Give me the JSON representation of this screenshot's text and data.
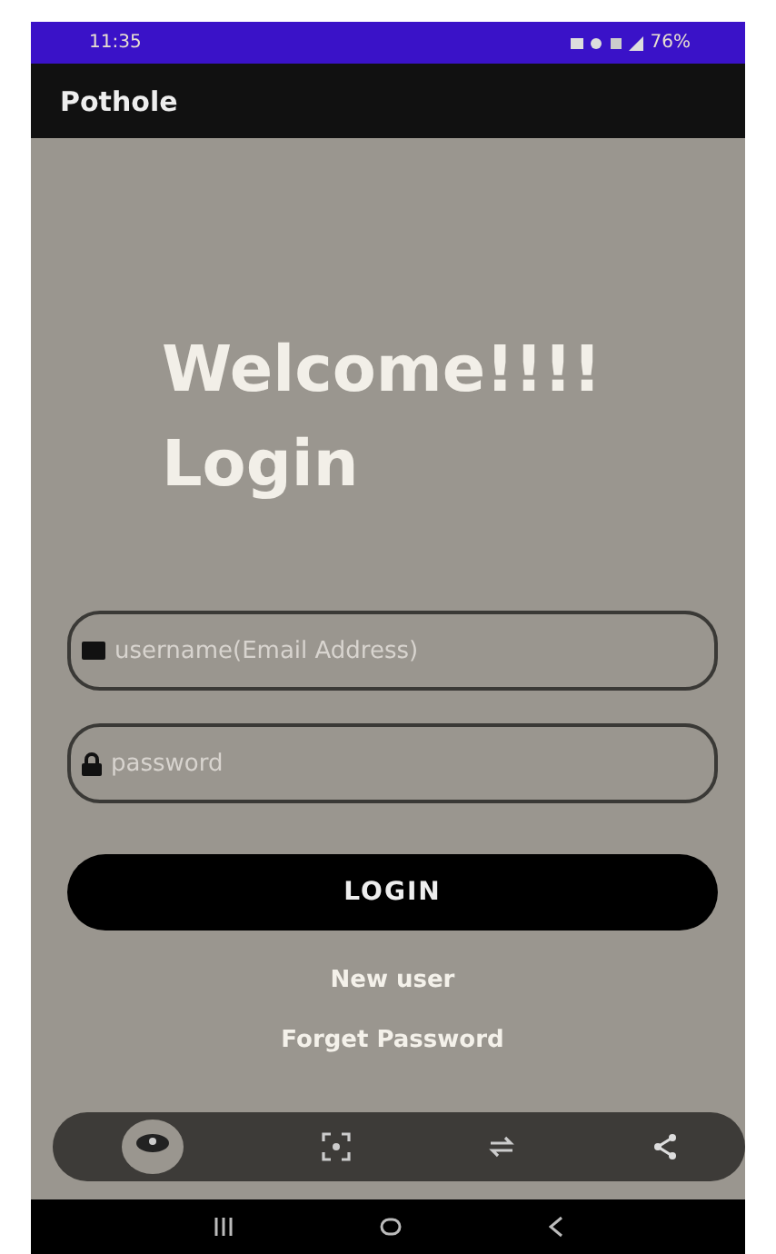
{
  "status_bar": {
    "time": "11:35",
    "battery": "76%"
  },
  "app_bar": {
    "title": "Pothole"
  },
  "heading": {
    "line_1": "Welcome!!!!",
    "line_2": "Login"
  },
  "fields": [
    {
      "kind": "email",
      "placeholder": "username(Email Address)"
    },
    {
      "kind": "password",
      "placeholder": "password"
    }
  ],
  "login_button": "LOGIN",
  "links": [
    "New user",
    "Forget Password"
  ]
}
